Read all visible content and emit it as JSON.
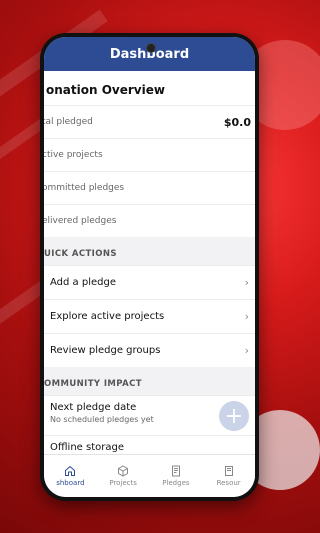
{
  "header": {
    "title": "Dashboard"
  },
  "overview": {
    "title": "onation Overview",
    "stats": [
      {
        "label": "tal pledged",
        "value": "$0.0"
      },
      {
        "label": "ctive projects",
        "value": ""
      },
      {
        "label": "ommitted pledges",
        "value": ""
      },
      {
        "label": "elivered pledges",
        "value": ""
      }
    ]
  },
  "quick_actions": {
    "label": "UICK ACTIONS",
    "items": [
      {
        "label": "Add a pledge"
      },
      {
        "label": "Explore active projects"
      },
      {
        "label": "Review pledge groups"
      }
    ]
  },
  "community_impact": {
    "label": "OMMUNITY IMPACT",
    "items": [
      {
        "title": "Next pledge date",
        "subtitle": "No scheduled pledges yet"
      },
      {
        "title": "Offline storage",
        "subtitle": ""
      }
    ]
  },
  "tabs": [
    {
      "label": "shboard",
      "icon": "home-icon",
      "active": true
    },
    {
      "label": "Projects",
      "icon": "cube-icon",
      "active": false
    },
    {
      "label": "Pledges",
      "icon": "document-icon",
      "active": false
    },
    {
      "label": "Resour",
      "icon": "book-icon",
      "active": false
    }
  ],
  "colors": {
    "accent": "#2d4c93",
    "background": "#d81b1b"
  }
}
